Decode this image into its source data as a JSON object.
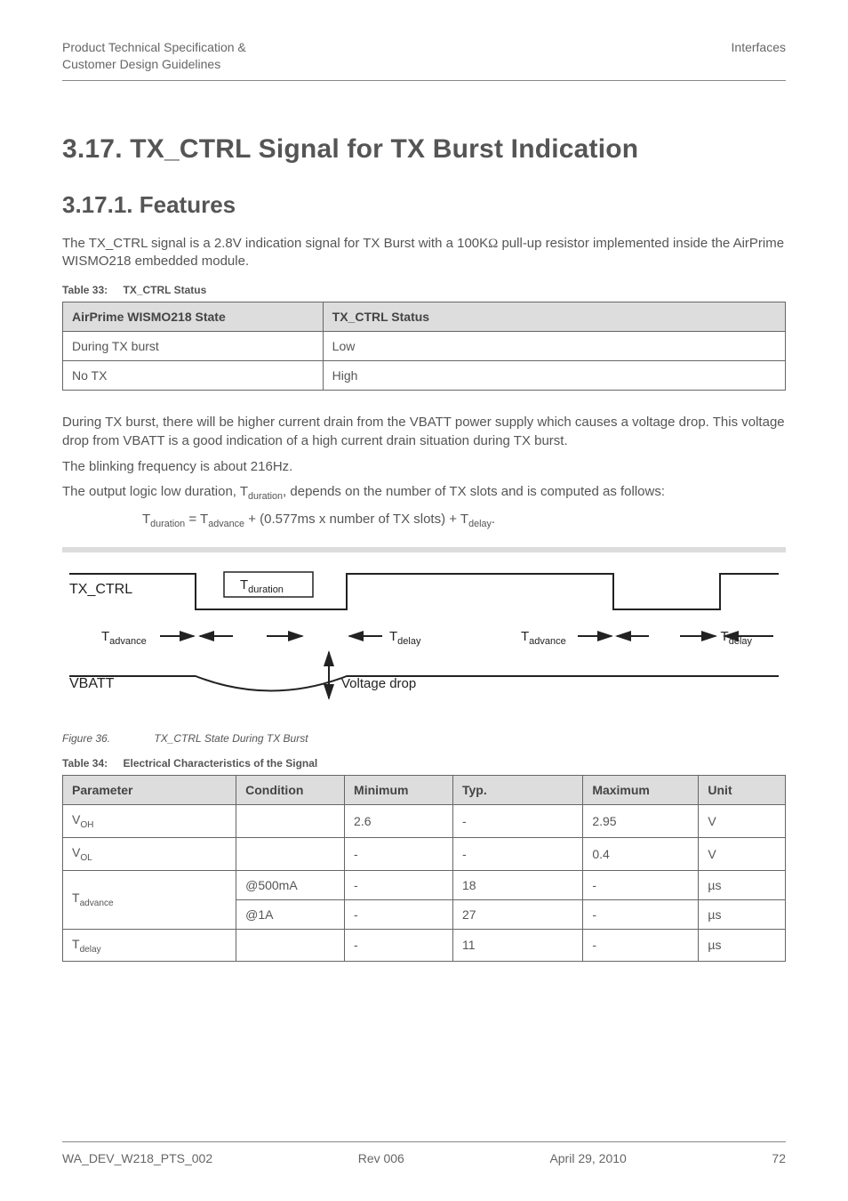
{
  "header": {
    "line1": "Product Technical Specification &",
    "line2": "Customer Design Guidelines",
    "right": "Interfaces"
  },
  "h1": "3.17.   TX_CTRL Signal for TX Burst Indication",
  "h2": "3.17.1.   Features",
  "para1a": "The TX_CTRL signal is a 2.8V indication signal for TX Burst with a 100K",
  "para1b": " pull-up resistor implemented inside the AirPrime WISMO218 embedded module.",
  "table33_caption_num": "Table 33:",
  "table33_caption_txt": "TX_CTRL Status",
  "table33": {
    "headers": [
      "AirPrime WISMO218 State",
      "TX_CTRL Status"
    ],
    "rows": [
      {
        "c0": "During TX burst",
        "c1": "Low"
      },
      {
        "c0": "No TX",
        "c1": "High"
      }
    ]
  },
  "para2": "During TX burst, there will be higher current drain from the VBATT power supply which causes a voltage drop. This voltage drop from VBATT is a good indication of a high current drain situation during TX burst.",
  "para3": "The blinking frequency is about 216Hz.",
  "para4a": "The output logic low duration, T",
  "para4a_sub": "duration",
  "para4b": ", depends on the number of TX slots and is computed as follows:",
  "formula_parts": {
    "a": "T",
    "a_sub": "duration",
    "b": " = T",
    "b_sub": "advance",
    "c": " + (0.577ms x number of TX slots) + T",
    "c_sub": "delay",
    "d": "."
  },
  "figure_labels": {
    "tx_ctrl": "TX_CTRL",
    "vbatt": "VBATT",
    "t_duration": "T",
    "t_duration_sub": "duration",
    "t_advance": "T",
    "t_advance_sub": "advance",
    "t_delay": "T",
    "t_delay_sub": "delay",
    "voltage_drop": "Voltage drop"
  },
  "fig36_num": "Figure 36.",
  "fig36_txt": "TX_CTRL State During TX Burst",
  "table34_caption_num": "Table 34:",
  "table34_caption_txt": "Electrical Characteristics of the Signal",
  "table34": {
    "headers": [
      "Parameter",
      "Condition",
      "Minimum",
      "Typ.",
      "Maximum",
      "Unit"
    ],
    "rows": [
      {
        "param_html": "V<sub>OH</sub>",
        "cond": "",
        "min": "2.6",
        "typ": "-",
        "max": "2.95",
        "unit": "V"
      },
      {
        "param_html": "V<sub>OL</sub>",
        "cond": "",
        "min": "-",
        "typ": "-",
        "max": "0.4",
        "unit": "V"
      },
      {
        "param_html": "T<sub>advance</sub>",
        "cond": "@500mA",
        "min": "-",
        "typ": "18",
        "max": "-",
        "unit": "µs"
      },
      {
        "param_html": "",
        "cond": "@1A",
        "min": "-",
        "typ": "27",
        "max": "-",
        "unit": "µs"
      },
      {
        "param_html": "T<sub>delay</sub>",
        "cond": "",
        "min": "-",
        "typ": "11",
        "max": "-",
        "unit": "µs"
      }
    ]
  },
  "footer": {
    "left": "WA_DEV_W218_PTS_002",
    "mid": "Rev 006",
    "right1": "April 29, 2010",
    "right2": "72"
  }
}
